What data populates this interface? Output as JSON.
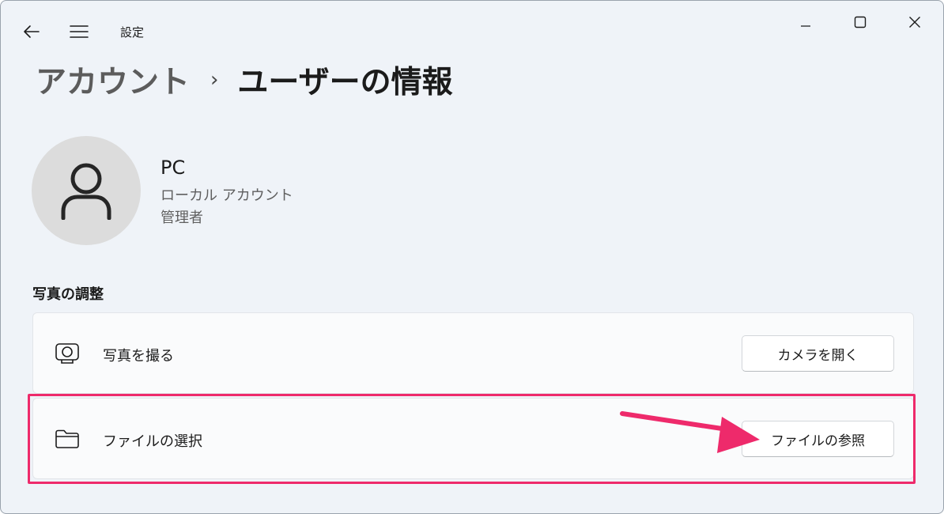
{
  "window": {
    "title": "設定",
    "controls": {
      "minimize_icon": "minimize-icon",
      "maximize_icon": "maximize-icon",
      "close_icon": "close-icon"
    }
  },
  "nav": {
    "back_icon": "back-arrow-icon",
    "menu_icon": "hamburger-menu-icon"
  },
  "breadcrumb": {
    "parent": "アカウント",
    "separator": "›",
    "current": "ユーザーの情報"
  },
  "profile": {
    "avatar_icon": "person-icon",
    "name": "PC",
    "account_type": "ローカル アカウント",
    "role": "管理者"
  },
  "photo_section": {
    "title": "写真の調整",
    "rows": [
      {
        "icon": "camera-icon",
        "label": "写真を撮る",
        "button_label": "カメラを開く"
      },
      {
        "icon": "folder-icon",
        "label": "ファイルの選択",
        "button_label": "ファイルの参照"
      }
    ]
  },
  "colors": {
    "window_background": "#eff3f8",
    "card_background": "#fafbfc",
    "annotation": "#ee2a6b"
  }
}
